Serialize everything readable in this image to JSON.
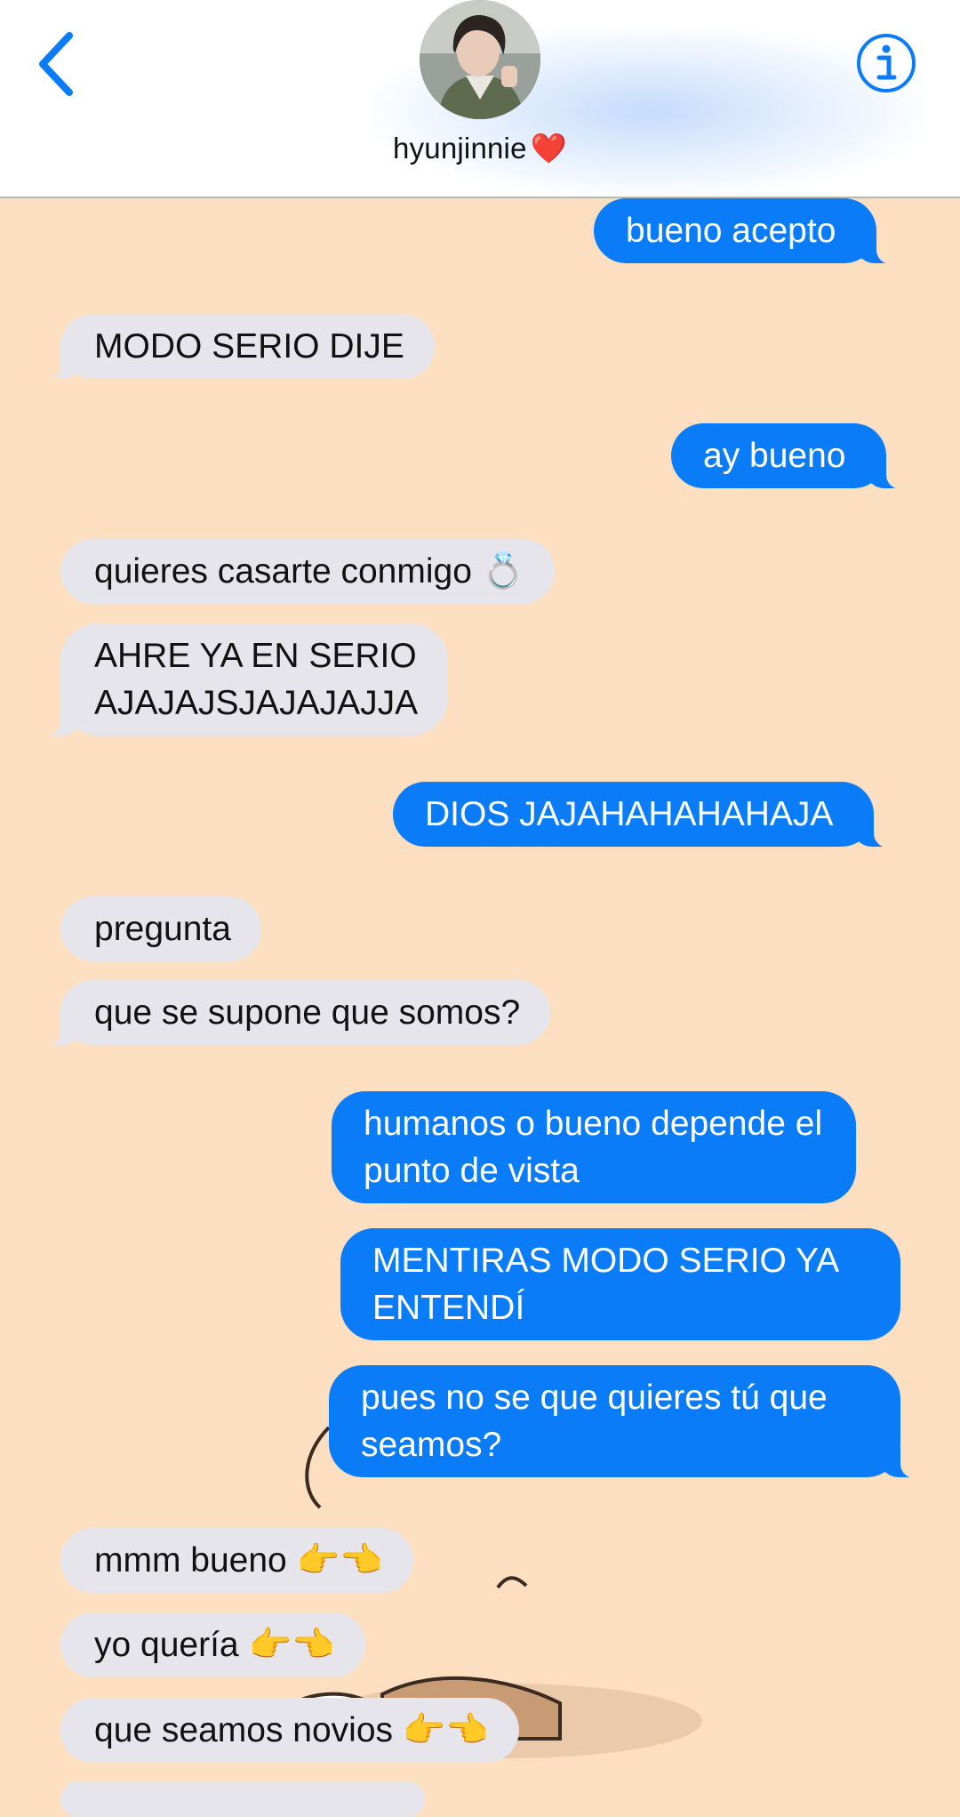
{
  "header": {
    "contact_name": "hyunjinnie",
    "name_emoji": "❤️",
    "back_icon": "chevron-left-icon",
    "info_icon": "info-circle-icon",
    "accent_color": "#0b7cf7"
  },
  "messages": [
    {
      "from": "me",
      "text": "bueno acepto"
    },
    {
      "from": "them",
      "text": "MODO SERIO DIJE"
    },
    {
      "from": "me",
      "text": "ay bueno"
    },
    {
      "from": "them",
      "text": "quieres casarte conmigo 💍"
    },
    {
      "from": "them",
      "lines": [
        "AHRE YA EN SERIO",
        "AJAJAJSJAJAJAJJA"
      ]
    },
    {
      "from": "me",
      "text": "DIOS JAJAHAHAHAHAJA"
    },
    {
      "from": "them",
      "text": "pregunta"
    },
    {
      "from": "them",
      "text": "que se supone que somos?"
    },
    {
      "from": "me",
      "lines": [
        "humanos o bueno depende el",
        "punto de vista"
      ]
    },
    {
      "from": "me",
      "lines": [
        "MENTIRAS MODO SERIO YA",
        "ENTENDÍ"
      ]
    },
    {
      "from": "me",
      "lines": [
        "pues no se que quieres tú que",
        "seamos?"
      ]
    },
    {
      "from": "them",
      "text": "mmm bueno 👉👈"
    },
    {
      "from": "them",
      "text": "yo quería 👉👈"
    },
    {
      "from": "them",
      "text": "que seamos novios 👉👈"
    }
  ],
  "colors": {
    "background": "#fbdfc0",
    "incoming_bubble": "#e6e5eb",
    "outgoing_bubble": "#0b7cf7"
  }
}
